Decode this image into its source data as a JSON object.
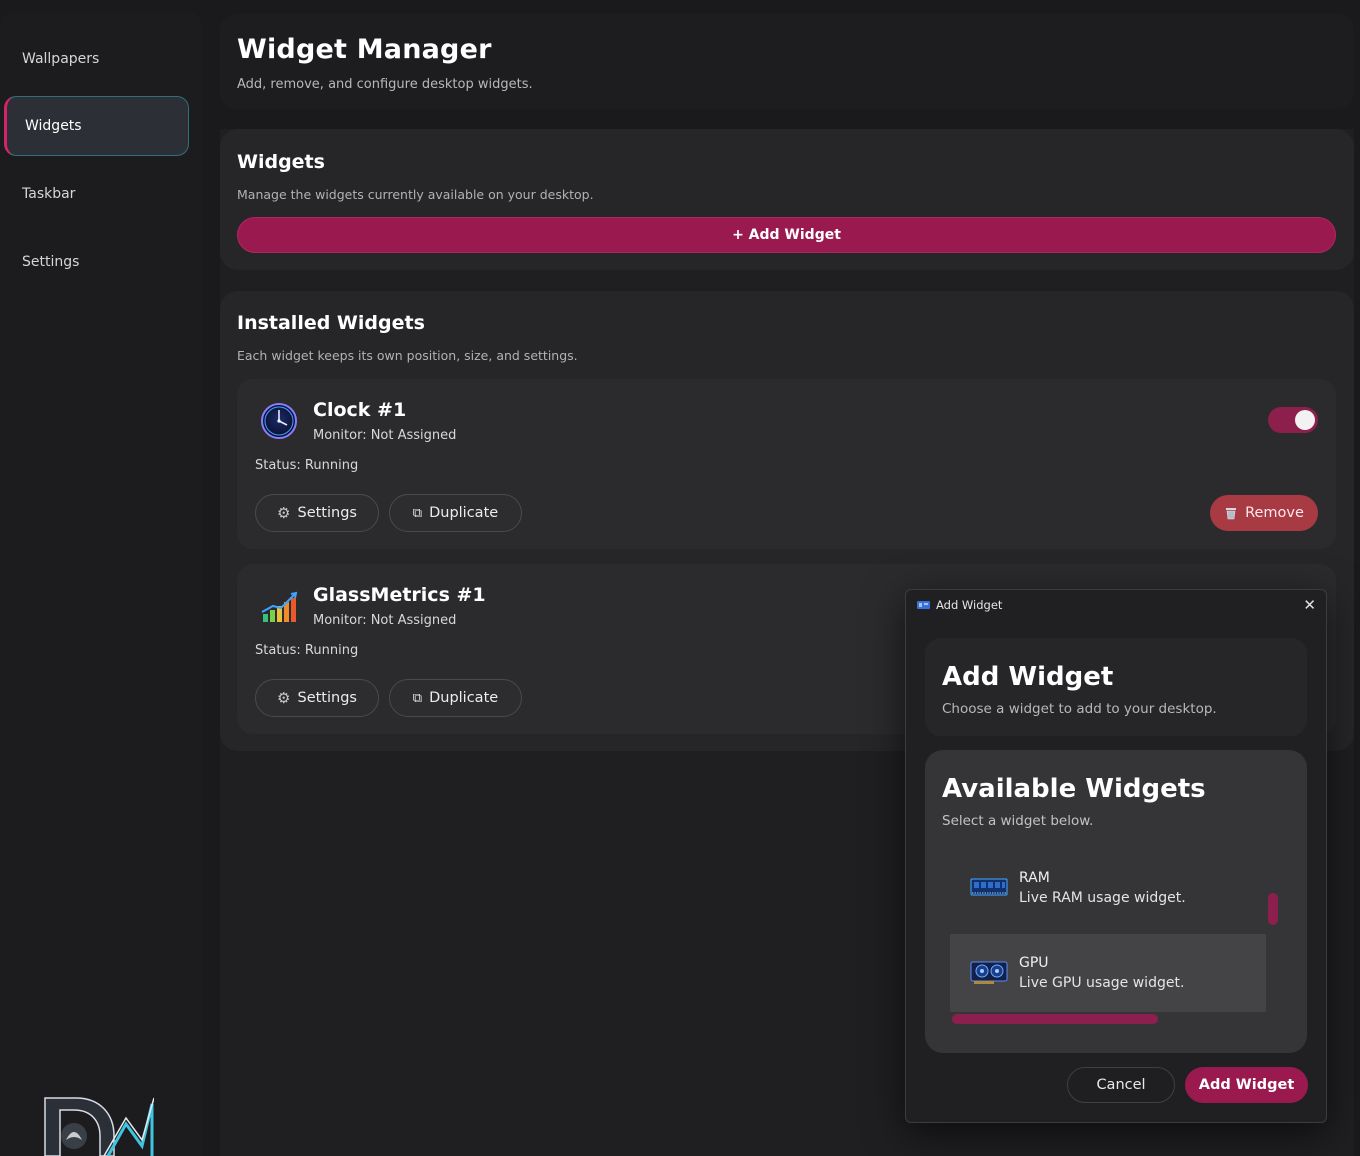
{
  "sidebar": {
    "items": [
      {
        "label": "Wallpapers",
        "active": false
      },
      {
        "label": "Widgets",
        "active": true
      },
      {
        "label": "Taskbar",
        "active": false
      },
      {
        "label": "Settings",
        "active": false
      }
    ],
    "logo_text": "DM"
  },
  "header": {
    "title": "Widget Manager",
    "subtitle": "Add, remove, and configure desktop widgets."
  },
  "widgets_section": {
    "title": "Widgets",
    "subtitle": "Manage the widgets currently available on your desktop.",
    "add_button_label": "+ Add Widget"
  },
  "installed_section": {
    "title": "Installed Widgets",
    "subtitle": "Each widget keeps its own position, size, and settings.",
    "widgets": [
      {
        "icon": "clock-icon",
        "name": "Clock #1",
        "monitor": "Monitor: Not Assigned",
        "status": "Status: Running",
        "enabled": true,
        "settings_label": "Settings",
        "duplicate_label": "Duplicate",
        "remove_label": "Remove"
      },
      {
        "icon": "metrics-chart-icon",
        "name": "GlassMetrics #1",
        "monitor": "Monitor: Not Assigned",
        "status": "Status: Running",
        "settings_label": "Settings",
        "duplicate_label": "Duplicate"
      }
    ]
  },
  "dialog": {
    "window_title": "Add Widget",
    "close_glyph": "✕",
    "title": "Add Widget",
    "subtitle": "Choose a widget to add to your desktop.",
    "available_title": "Available Widgets",
    "available_subtitle": "Select a widget below.",
    "items": [
      {
        "icon": "ram-icon",
        "name": "RAM",
        "description": "Live RAM usage widget.",
        "selected": false
      },
      {
        "icon": "gpu-icon",
        "name": "GPU",
        "description": "Live GPU usage widget.",
        "selected": true
      }
    ],
    "cancel_label": "Cancel",
    "confirm_label": "Add Widget"
  },
  "colors": {
    "accent": "#9a1a50",
    "accent_border": "#d1246a",
    "remove": "#a83a44",
    "background": "#1a1a1c"
  }
}
